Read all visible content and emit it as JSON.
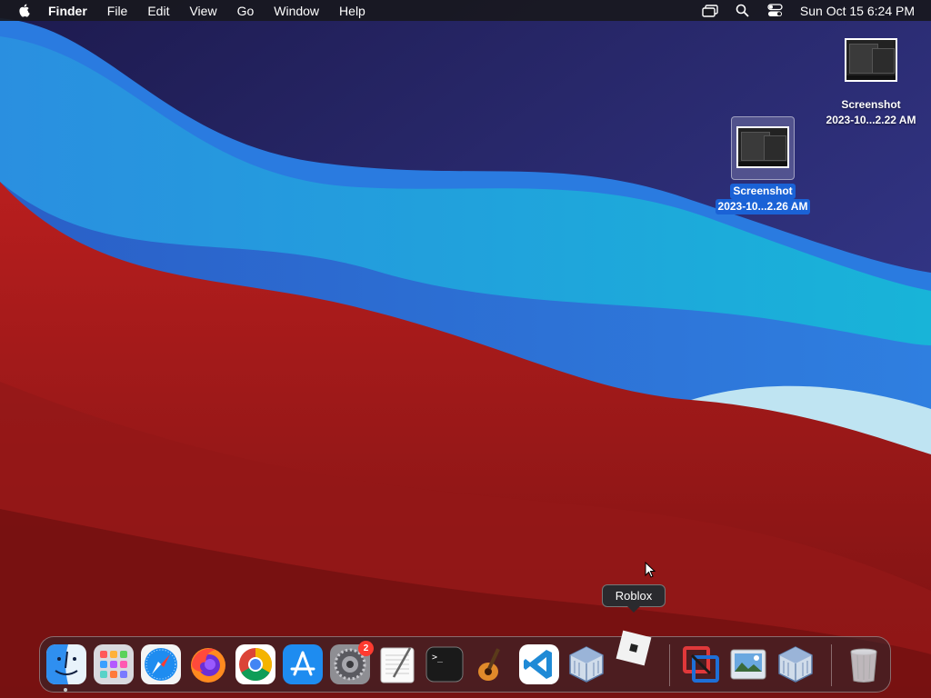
{
  "menubar": {
    "apple_icon": "apple-logo-icon",
    "app_name": "Finder",
    "menus": [
      "File",
      "Edit",
      "View",
      "Go",
      "Window",
      "Help"
    ],
    "status_icons": [
      "screen-mirroring-icon",
      "spotlight-search-icon",
      "control-center-icon"
    ],
    "clock": "Sun Oct 15  6:24 PM"
  },
  "desktop": {
    "icons": [
      {
        "line1": "Screenshot",
        "line2": "2023-10...2.22 AM",
        "selected": false
      },
      {
        "line1": "Screenshot",
        "line2": "2023-10...2.26 AM",
        "selected": true
      }
    ]
  },
  "tooltip": {
    "label": "Roblox"
  },
  "dock": {
    "apps": [
      {
        "name": "Finder",
        "icon": "finder-icon",
        "running": true
      },
      {
        "name": "Launchpad",
        "icon": "launchpad-icon"
      },
      {
        "name": "Safari",
        "icon": "safari-icon"
      },
      {
        "name": "Firefox",
        "icon": "firefox-icon"
      },
      {
        "name": "Google Chrome",
        "icon": "chrome-icon"
      },
      {
        "name": "App Store",
        "icon": "app-store-icon"
      },
      {
        "name": "System Settings",
        "icon": "system-settings-icon",
        "badge": "2"
      },
      {
        "name": "TextEdit",
        "icon": "textedit-icon"
      },
      {
        "name": "Terminal",
        "icon": "terminal-icon",
        "glyph": ">_"
      },
      {
        "name": "GarageBand",
        "icon": "garageband-icon"
      },
      {
        "name": "Visual Studio Code",
        "icon": "vscode-icon"
      },
      {
        "name": "VirtualBox",
        "icon": "virtualbox-icon"
      },
      {
        "name": "Roblox",
        "icon": "roblox-icon"
      },
      {
        "name": "Remote Desktop",
        "icon": "remote-desktop-icon"
      },
      {
        "name": "Preview",
        "icon": "preview-icon"
      },
      {
        "name": "VirtualBox VM",
        "icon": "virtualbox-vm-icon"
      },
      {
        "name": "Trash",
        "icon": "trash-icon"
      }
    ]
  },
  "colors": {
    "menubar_bg": "#18181e",
    "selection_blue": "#1a62d6",
    "badge_red": "#ff3b30",
    "wallpaper_navy": "#23215a",
    "wallpaper_blue": "#2b6fd6",
    "wallpaper_cyan": "#1ab0d6",
    "wallpaper_red": "#b81e1e"
  }
}
